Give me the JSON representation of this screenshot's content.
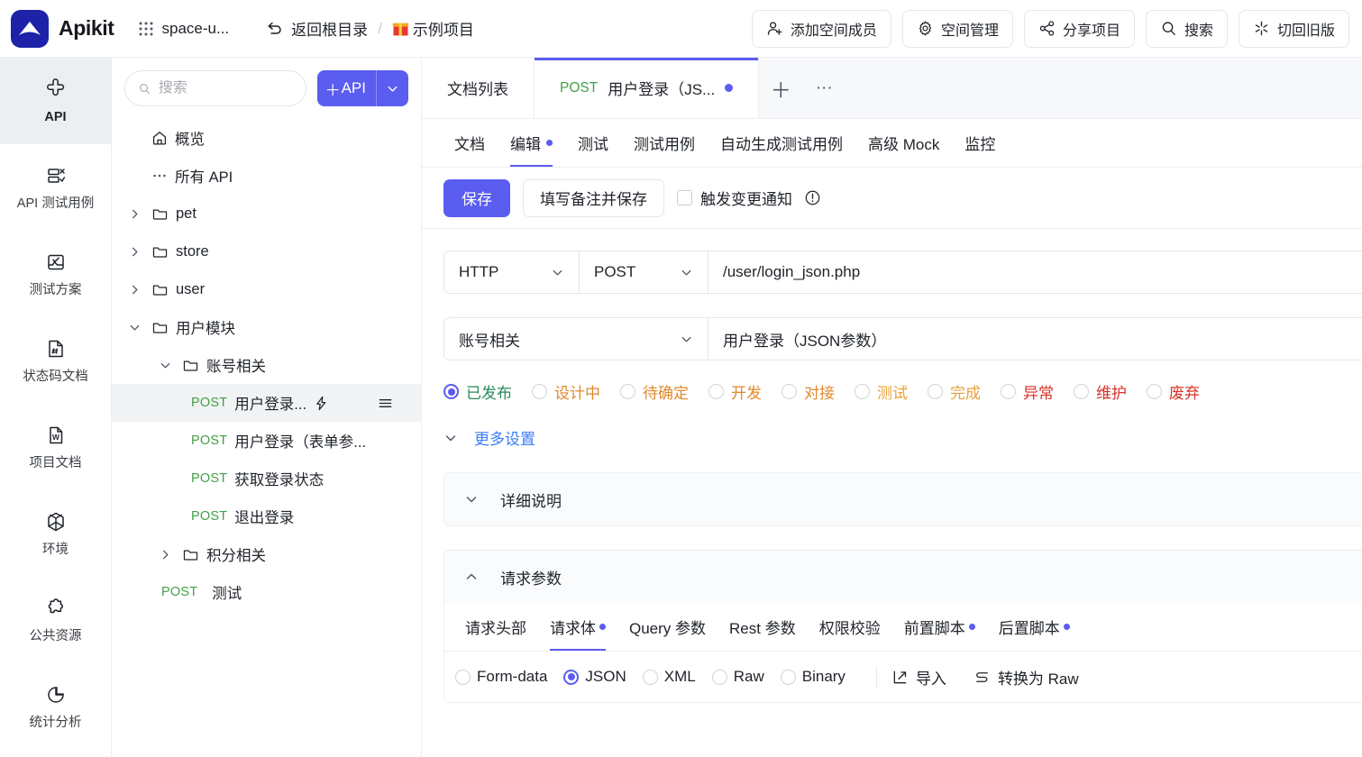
{
  "header": {
    "brand": "Apikit",
    "space_name": "space-u...",
    "back_root": "返回根目录",
    "separator": "/",
    "project_name": "示例项目",
    "buttons": [
      {
        "label": "添加空间成员",
        "icon": "add-member-icon"
      },
      {
        "label": "空间管理",
        "icon": "gear-icon"
      },
      {
        "label": "分享项目",
        "icon": "share-icon"
      },
      {
        "label": "搜索",
        "icon": "search-icon"
      },
      {
        "label": "切回旧版",
        "icon": "sparkle-icon"
      }
    ]
  },
  "rail": {
    "items": [
      {
        "label": "API",
        "icon": "api-icon",
        "active": true
      },
      {
        "label": "API 测试用例",
        "icon": "testcase-icon",
        "active": false
      },
      {
        "label": "测试方案",
        "icon": "testplan-icon",
        "active": false
      },
      {
        "label": "状态码文档",
        "icon": "status-code-icon",
        "active": false
      },
      {
        "label": "项目文档",
        "icon": "word-doc-icon",
        "active": false
      },
      {
        "label": "环境",
        "icon": "cube-icon",
        "active": false
      },
      {
        "label": "公共资源",
        "icon": "puzzle-icon",
        "active": false
      },
      {
        "label": "统计分析",
        "icon": "pie-chart-icon",
        "active": false
      }
    ]
  },
  "sidebar": {
    "search_placeholder": "搜索",
    "search_value": "",
    "add_api_label": "API",
    "add_api_plus": "＋",
    "tree": [
      {
        "label": "概览",
        "icon": "home-icon",
        "indent": 0,
        "twist": "",
        "method": ""
      },
      {
        "label": "所有 API",
        "icon": "dots-icon",
        "indent": 0,
        "twist": "",
        "method": ""
      },
      {
        "label": "pet",
        "icon": "folder-icon",
        "indent": 0,
        "twist": "right",
        "method": ""
      },
      {
        "label": "store",
        "icon": "folder-icon",
        "indent": 0,
        "twist": "right",
        "method": ""
      },
      {
        "label": "user",
        "icon": "folder-icon",
        "indent": 0,
        "twist": "right",
        "method": ""
      },
      {
        "label": "用户模块",
        "icon": "folder-icon",
        "indent": 0,
        "twist": "down",
        "method": ""
      },
      {
        "label": "账号相关",
        "icon": "folder-icon",
        "indent": 1,
        "twist": "down",
        "method": ""
      },
      {
        "label": "用户登录...",
        "icon": "",
        "indent": 2,
        "twist": "",
        "method": "POST",
        "selected": true,
        "trailing": "bolt-menu"
      },
      {
        "label": "用户登录（表单参...",
        "icon": "",
        "indent": 2,
        "twist": "",
        "method": "POST"
      },
      {
        "label": "获取登录状态",
        "icon": "",
        "indent": 2,
        "twist": "",
        "method": "POST"
      },
      {
        "label": "退出登录",
        "icon": "",
        "indent": 2,
        "twist": "",
        "method": "POST"
      },
      {
        "label": "积分相关",
        "icon": "folder-icon",
        "indent": 1,
        "twist": "right",
        "method": ""
      },
      {
        "label": "测试",
        "icon": "",
        "indent": 1,
        "twist": "",
        "method": "POST"
      }
    ]
  },
  "doc_tabs": {
    "tabs": [
      {
        "label": "文档列表",
        "method": "",
        "dot": false,
        "active": false
      },
      {
        "label": "用户登录（JS...",
        "method": "POST",
        "dot": true,
        "active": true
      }
    ],
    "add": "＋",
    "more": "···"
  },
  "sub_tabs": [
    {
      "label": "文档",
      "dot": false,
      "active": false
    },
    {
      "label": "编辑",
      "dot": true,
      "active": true
    },
    {
      "label": "测试",
      "dot": false,
      "active": false
    },
    {
      "label": "测试用例",
      "dot": false,
      "active": false
    },
    {
      "label": "自动生成测试用例",
      "dot": false,
      "active": false
    },
    {
      "label": "高级 Mock",
      "dot": false,
      "active": false
    },
    {
      "label": "监控",
      "dot": false,
      "active": false
    }
  ],
  "action_bar": {
    "save": "保存",
    "save_with_note": "填写备注并保存",
    "notify_label": "触发变更通知",
    "notify_checked": false,
    "info_icon": "info-circle-icon"
  },
  "request_line": {
    "protocol": "HTTP",
    "method": "POST",
    "url": "/user/login_json.php"
  },
  "meta_line": {
    "group": "账号相关",
    "name": "用户登录（JSON参数）"
  },
  "status_options": [
    {
      "label": "已发布",
      "color": "#2a8a5f",
      "selected": true
    },
    {
      "label": "设计中",
      "color": "#e08a2e",
      "selected": false
    },
    {
      "label": "待确定",
      "color": "#e08a2e",
      "selected": false
    },
    {
      "label": "开发",
      "color": "#e08a2e",
      "selected": false
    },
    {
      "label": "对接",
      "color": "#e08a2e",
      "selected": false
    },
    {
      "label": "测试",
      "color": "#e8a33d",
      "selected": false
    },
    {
      "label": "完成",
      "color": "#e8a33d",
      "selected": false
    },
    {
      "label": "异常",
      "color": "#d93026",
      "selected": false
    },
    {
      "label": "维护",
      "color": "#d93026",
      "selected": false
    },
    {
      "label": "废弃",
      "color": "#d93026",
      "selected": false
    }
  ],
  "more_settings": {
    "label": "更多设置",
    "expanded": false
  },
  "panels": [
    {
      "title": "详细说明",
      "expanded": false
    },
    {
      "title": "请求参数",
      "expanded": true
    }
  ],
  "param_tabs": [
    {
      "label": "请求头部",
      "dot": false,
      "active": false
    },
    {
      "label": "请求体",
      "dot": true,
      "active": true
    },
    {
      "label": "Query 参数",
      "dot": false,
      "active": false
    },
    {
      "label": "Rest 参数",
      "dot": false,
      "active": false
    },
    {
      "label": "权限校验",
      "dot": false,
      "active": false
    },
    {
      "label": "前置脚本",
      "dot": true,
      "active": false
    },
    {
      "label": "后置脚本",
      "dot": true,
      "active": false
    }
  ],
  "body_types": [
    {
      "label": "Form-data",
      "selected": false
    },
    {
      "label": "JSON",
      "selected": true
    },
    {
      "label": "XML",
      "selected": false
    },
    {
      "label": "Raw",
      "selected": false
    },
    {
      "label": "Binary",
      "selected": false
    }
  ],
  "body_tools": [
    {
      "label": "导入",
      "icon": "import-icon"
    },
    {
      "label": "转换为 Raw",
      "icon": "convert-icon"
    }
  ],
  "colors": {
    "accent": "#5b5cf0",
    "method_post": "#43a047",
    "link": "#377cf6",
    "logo_bg": "#1d22a8"
  }
}
